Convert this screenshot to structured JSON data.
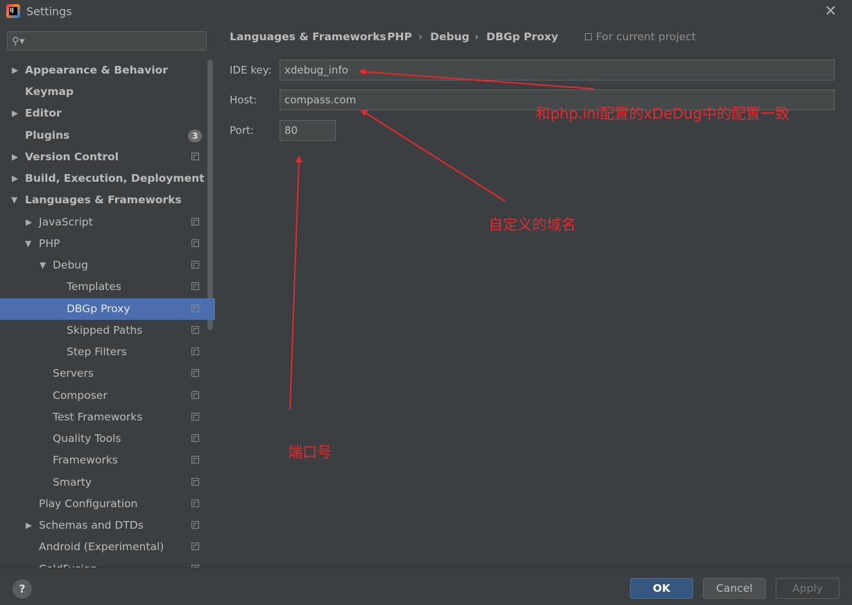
{
  "window": {
    "title": "Settings"
  },
  "sidebar": {
    "search_placeholder": "",
    "items": [
      {
        "label": "Appearance & Behavior"
      },
      {
        "label": "Keymap"
      },
      {
        "label": "Editor"
      },
      {
        "label": "Plugins",
        "badge": "3"
      },
      {
        "label": "Version Control"
      },
      {
        "label": "Build, Execution, Deployment"
      },
      {
        "label": "Languages & Frameworks"
      },
      {
        "label": "JavaScript"
      },
      {
        "label": "PHP"
      },
      {
        "label": "Debug"
      },
      {
        "label": "Templates"
      },
      {
        "label": "DBGp Proxy"
      },
      {
        "label": "Skipped Paths"
      },
      {
        "label": "Step Filters"
      },
      {
        "label": "Servers"
      },
      {
        "label": "Composer"
      },
      {
        "label": "Test Frameworks"
      },
      {
        "label": "Quality Tools"
      },
      {
        "label": "Frameworks"
      },
      {
        "label": "Smarty"
      },
      {
        "label": "Play Configuration"
      },
      {
        "label": "Schemas and DTDs"
      },
      {
        "label": "Android (Experimental)"
      },
      {
        "label": "ColdFusion"
      }
    ]
  },
  "breadcrumb": {
    "items": [
      "Languages & Frameworks",
      "PHP",
      "Debug",
      "DBGp Proxy"
    ],
    "separator": "›",
    "scope": "For current project"
  },
  "form": {
    "ide_key_label": "IDE key:",
    "ide_key_value": "xdebug_info",
    "host_label": "Host:",
    "host_value": "compass.com",
    "port_label": "Port:",
    "port_value": "80"
  },
  "annotations": {
    "config_note": "和php.ini配置的xDeDug中的配置一致",
    "domain_note": "自定义的域名",
    "port_note": "端口号"
  },
  "buttons": {
    "help": "?",
    "ok": "OK",
    "cancel": "Cancel",
    "apply": "Apply"
  },
  "colors": {
    "selection": "#4b6eaf",
    "annotation": "#e8292b",
    "ok_button": "#365880"
  }
}
